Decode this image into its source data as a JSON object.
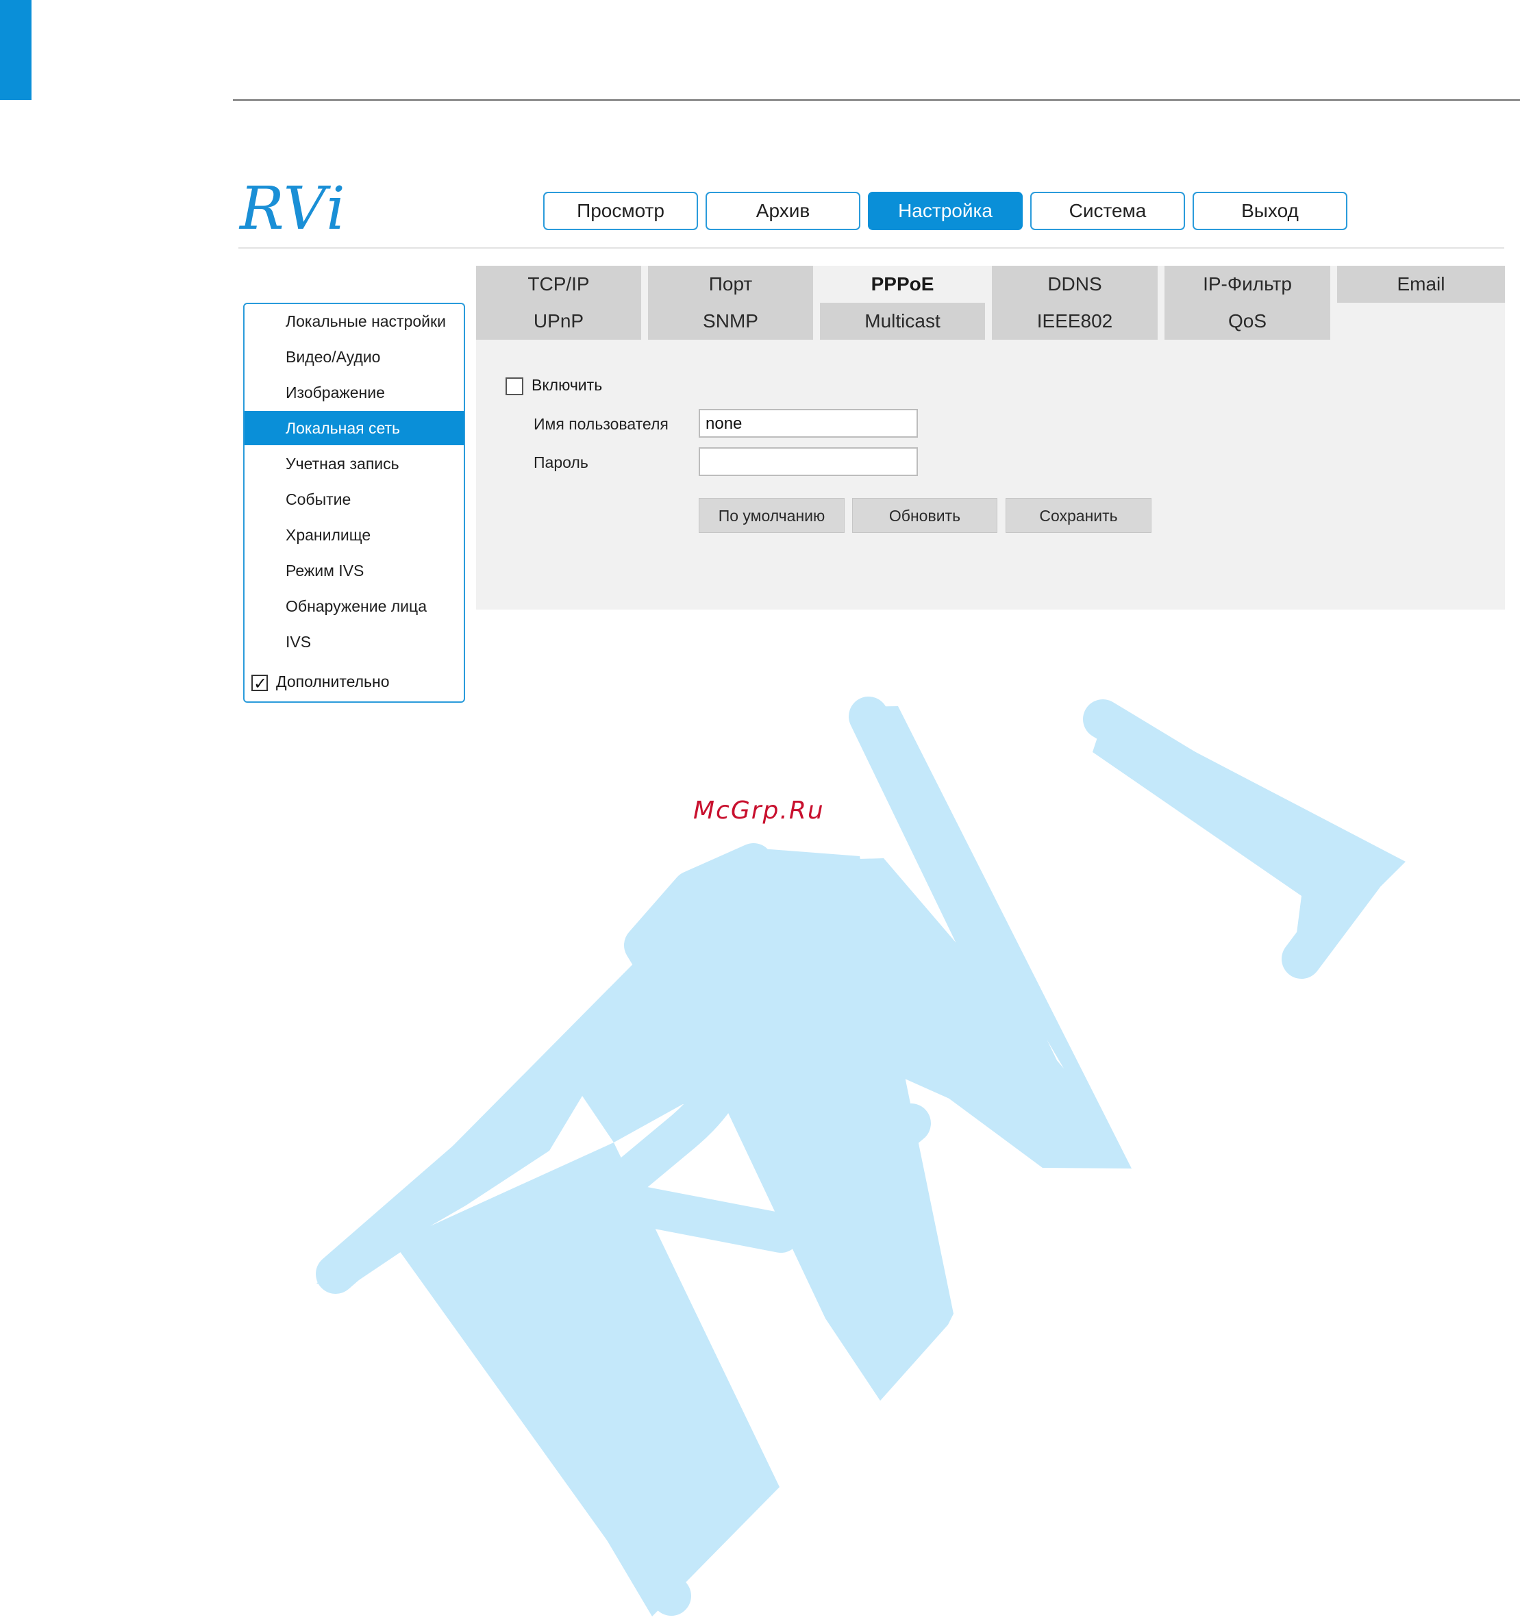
{
  "brand": {
    "logo_text": "RVi"
  },
  "top_nav": [
    {
      "label": "Просмотр",
      "active": false
    },
    {
      "label": "Архив",
      "active": false
    },
    {
      "label": "Настройка",
      "active": true
    },
    {
      "label": "Система",
      "active": false
    },
    {
      "label": "Выход",
      "active": false
    }
  ],
  "sidebar": {
    "items": [
      {
        "label": "Локальные настройки",
        "active": false
      },
      {
        "label": "Видео/Аудио",
        "active": false
      },
      {
        "label": "Изображение",
        "active": false
      },
      {
        "label": "Локальная сеть",
        "active": true
      },
      {
        "label": "Учетная запись",
        "active": false
      },
      {
        "label": "Событие",
        "active": false
      },
      {
        "label": "Хранилище",
        "active": false
      },
      {
        "label": "Режим IVS",
        "active": false
      },
      {
        "label": "Обнаружение лица",
        "active": false
      },
      {
        "label": "IVS",
        "active": false
      }
    ],
    "advanced": {
      "label": "Дополнительно",
      "checked": true
    }
  },
  "tabs": {
    "row1": [
      "TCP/IP",
      "Порт",
      "PPPoE",
      "DDNS",
      "IP-Фильтр",
      "Email"
    ],
    "row2": [
      "UPnP",
      "SNMP",
      "Multicast",
      "IEEE802",
      "QoS"
    ],
    "selected": "PPPoE"
  },
  "form": {
    "enable_label": "Включить",
    "enable_checked": false,
    "username_label": "Имя пользователя",
    "username_value": "none",
    "password_label": "Пароль",
    "password_value": ""
  },
  "buttons": {
    "default": "По умолчанию",
    "refresh": "Обновить",
    "save": "Сохранить"
  },
  "watermark": {
    "site": "McGrp.Ru",
    "logo_text": "RVi"
  },
  "colors": {
    "accent": "#0a8fd8",
    "panel": "#f1f1f1",
    "tab": "#d2d2d2",
    "watermark": "#c4e8fa",
    "site": "#c8102e"
  }
}
